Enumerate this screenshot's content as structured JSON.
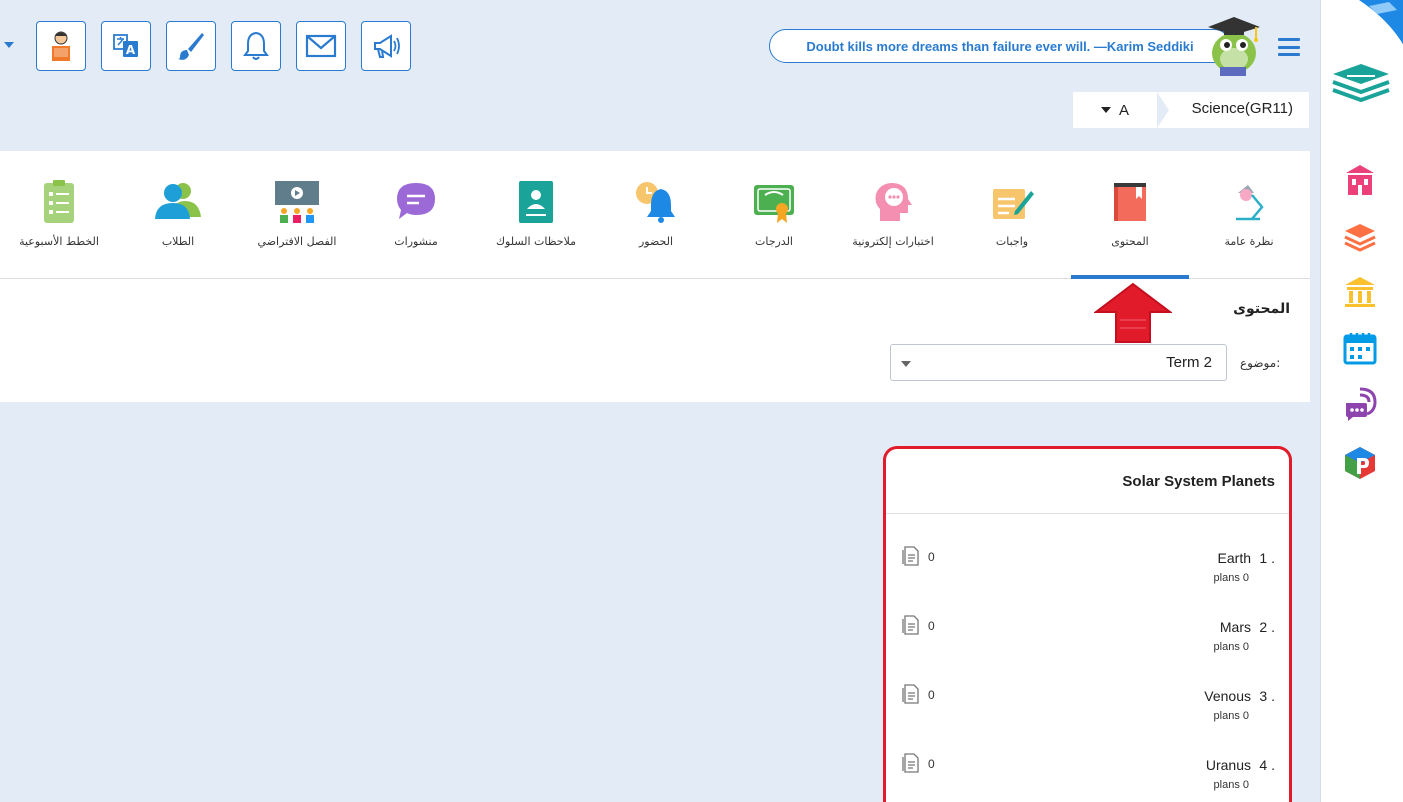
{
  "toolbar": {
    "buttons": [
      {
        "name": "parent-portal",
        "icon": "student-reading-icon"
      },
      {
        "name": "translate",
        "icon": "translate-icon"
      },
      {
        "name": "theme",
        "icon": "brush-icon"
      },
      {
        "name": "notifications",
        "icon": "bell-icon"
      },
      {
        "name": "messages",
        "icon": "envelope-icon"
      },
      {
        "name": "announcements",
        "icon": "megaphone-icon"
      }
    ],
    "quote": "Doubt kills more dreams than failure ever will. —Karim Seddiki"
  },
  "class_selector": {
    "section": "A",
    "class_name": "Science(GR11)"
  },
  "nav": {
    "tabs": [
      {
        "label": "نظرة عامة",
        "icon": "lamp-icon"
      },
      {
        "label": "المحتوى",
        "icon": "book-icon",
        "active": true
      },
      {
        "label": "واجبات",
        "icon": "homework-icon"
      },
      {
        "label": "اختبارات إلكترونية",
        "icon": "e-exam-icon"
      },
      {
        "label": "الدرجات",
        "icon": "certificate-icon"
      },
      {
        "label": "الحضور",
        "icon": "attendance-bell-icon"
      },
      {
        "label": "ملاحظات السلوك",
        "icon": "behavior-notes-icon"
      },
      {
        "label": "منشورات",
        "icon": "chat-bubble-icon"
      },
      {
        "label": "الفصل الافتراضي",
        "icon": "virtual-class-icon"
      },
      {
        "label": "الطلاب",
        "icon": "students-icon"
      },
      {
        "label": "الخطط الأسبوعية",
        "icon": "weekly-plan-icon"
      }
    ]
  },
  "content": {
    "title": "المحتوى",
    "topic_label": "موضوع:",
    "topic_value": "Term 2"
  },
  "card": {
    "title": "Solar System Planets",
    "lessons": [
      {
        "num": "1 .",
        "name": "Earth",
        "plans": "plans 0",
        "count": "0"
      },
      {
        "num": "2 .",
        "name": "Mars",
        "plans": "plans 0",
        "count": "0"
      },
      {
        "num": "3 .",
        "name": "Venous",
        "plans": "plans 0",
        "count": "0"
      },
      {
        "num": "4 .",
        "name": "Uranus",
        "plans": "plans 0",
        "count": "0"
      }
    ]
  },
  "colors": {
    "accent": "#2a7bd0",
    "highlight_red": "#e21b2b",
    "background": "#e3ecf6"
  },
  "sidebar": {
    "icons": [
      "school-icon",
      "books-icon",
      "institution-icon",
      "calendar-icon",
      "chat-icon",
      "p-app-icon"
    ]
  }
}
